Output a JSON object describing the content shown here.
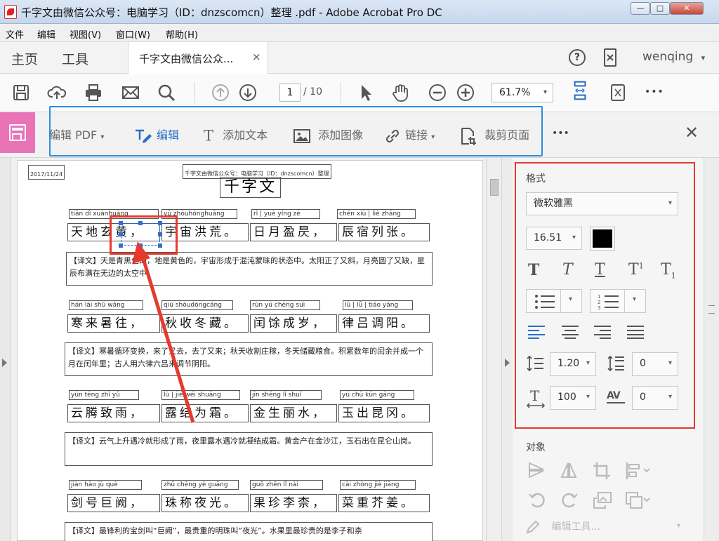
{
  "window": {
    "title": "千字文由微信公众号：电脑学习（ID：dnzscomcn）整理 .pdf - Adobe Acrobat Pro DC",
    "min_label": "—",
    "max_label": "□",
    "close_label": "✕"
  },
  "menu": [
    "文件",
    "编辑",
    "视图(V)",
    "窗口(W)",
    "帮助(H)"
  ],
  "tabs": {
    "home": "主页",
    "tools": "工具",
    "document": "千字文由微信公众...",
    "document_close": "×",
    "help_icon": "?",
    "user": "wenqing",
    "user_dd": "▾"
  },
  "toolbar": {
    "page_current": "1",
    "page_total": "/ 10",
    "zoom": "61.7%",
    "zoom_dd": "▾",
    "more": "•••"
  },
  "edit_toolbar": {
    "edit_pdf": "编辑 PDF",
    "edit_pdf_dd": "▾",
    "edit": "编辑",
    "add_text": "添加文本",
    "add_image": "添加图像",
    "link": "链接",
    "link_dd": "▾",
    "crop": "裁剪页面",
    "more": "•••",
    "close": "✕"
  },
  "document": {
    "date": "2017/11/24",
    "header": "千字文由微信公众号：电脑学习（ID：dnzscomcn）整理",
    "title": "千字文",
    "sections": [
      {
        "pinyin": [
          [
            "tiān",
            "dì",
            "xuán",
            "huáng"
          ],
          [
            "yǔ",
            "zhòu",
            "hóng",
            "huāng"
          ],
          [
            "rì",
            "yuè",
            "yíng",
            "zè"
          ],
          [
            "chén",
            "xiù",
            "liè",
            "zhāng"
          ]
        ],
        "hanzi": [
          "天地玄黄，",
          "宇宙洪荒。",
          "日月盈昃，",
          "辰宿列张。"
        ],
        "trans": "【译文】天是青黑色的，地是黄色的，宇宙形成于混沌蒙昧的状态中。太阳正了又斜，月亮圆了又缺，星辰布满在无边的太空中。"
      },
      {
        "pinyin": [
          [
            "hán",
            "lái",
            "shǔ",
            "wǎng"
          ],
          [
            "qiū",
            "shōu",
            "dōng",
            "cáng"
          ],
          [
            "rùn",
            "yú",
            "chéng",
            "suì"
          ],
          [
            "lǜ",
            "lǚ",
            "tiáo",
            "yáng"
          ]
        ],
        "hanzi": [
          "寒来暑往，",
          "秋收冬藏。",
          "闰馀成岁，",
          "律吕调阳。"
        ],
        "trans": "【译文】寒暑循环变换，来了又去，去了又来；秋天收割庄稼，冬天储藏粮食。积累数年的闰余并成一个月在闰年里；古人用六律六吕来调节阴阳。"
      },
      {
        "pinyin": [
          [
            "yún",
            "téng",
            "zhì",
            "yǔ"
          ],
          [
            "lù",
            "jié",
            "wéi",
            "shuāng"
          ],
          [
            "jīn",
            "shēng",
            "lì",
            "shuǐ"
          ],
          [
            "yù",
            "chū",
            "kūn",
            "gāng"
          ]
        ],
        "hanzi": [
          "云腾致雨，",
          "露结为霜。",
          "金生丽水，",
          "玉出昆冈。"
        ],
        "trans": "【译文】云气上升遇冷就形成了雨，夜里露水遇冷就凝结成霜。黄金产在金沙江，玉石出在昆仑山岗。"
      },
      {
        "pinyin": [
          [
            "jiàn",
            "hào",
            "jù",
            "què"
          ],
          [
            "zhū",
            "chēng",
            "yè",
            "guāng"
          ],
          [
            "guǒ",
            "zhēn",
            "lǐ",
            "nài"
          ],
          [
            "cài",
            "zhòng",
            "jiè",
            "jiāng"
          ]
        ],
        "hanzi": [
          "剑号巨阙，",
          "珠称夜光。",
          "果珍李柰，",
          "菜重芥姜。"
        ],
        "trans": "【译文】最锋利的宝剑叫“巨阙”，最贵重的明珠叫“夜光”。水果里最珍贵的是李子和柰"
      }
    ]
  },
  "format_panel": {
    "section": "格式",
    "font": "微软雅黑",
    "font_size": "16.51",
    "text_color": "#000000",
    "line_spacing": "1.20",
    "para_spacing": "0",
    "h_scale": "100",
    "char_spacing": "0",
    "dd": "▾",
    "av_label": "AV"
  },
  "objects_panel": {
    "section": "对象",
    "edit_tool": "编辑工具..."
  },
  "colors": {
    "accent": "#2d8ce0",
    "highlight": "#e53a2d",
    "edit_pink": "#e874b7"
  }
}
